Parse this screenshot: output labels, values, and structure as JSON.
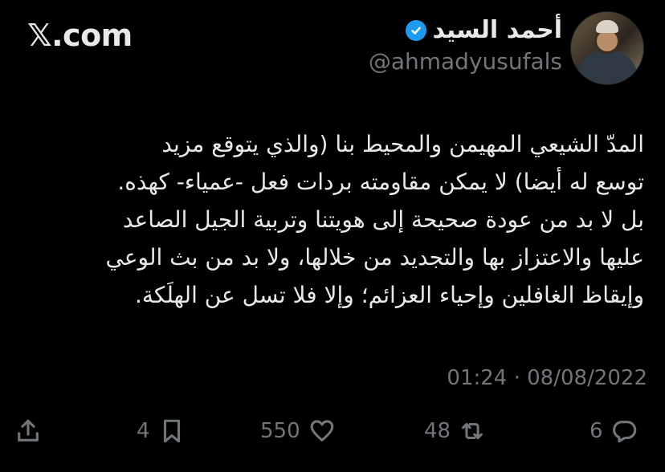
{
  "header": {
    "brand": "𝕏.com",
    "author_name": "أحمد السيد",
    "handle": "@ahmadyusufals"
  },
  "tweet": {
    "text": "المدّ الشيعي المهيمن والمحيط بنا (والذي يتوقع مزيد\nتوسع له أيضا) لا يمكن مقاومته بردات فعل -عمياء- كهذه.\nبل لا بد من عودة صحيحة إلى هويتنا وتربية الجيل الصاعد\nعليها والاعتزاز بها والتجديد من خلالها، ولا بد من بث الوعي\nوإيقاظ الغافلين وإحياء العزائم؛ وإلا فلا تسل عن الهلَكة.",
    "timestamp": "01:24 · 08/08/2022"
  },
  "actions": {
    "replies": "6",
    "reposts": "48",
    "likes": "550",
    "bookmarks": "4"
  },
  "colors": {
    "background": "#000000",
    "text": "#e7e9ea",
    "muted": "#71767b",
    "verified": "#1d9bf0"
  }
}
